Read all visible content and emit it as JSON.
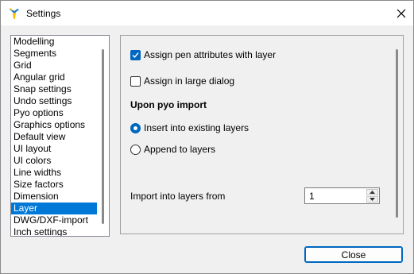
{
  "window": {
    "title": "Settings"
  },
  "sidebar": {
    "items": [
      {
        "label": "Modelling"
      },
      {
        "label": "Segments"
      },
      {
        "label": "Grid"
      },
      {
        "label": "Angular grid"
      },
      {
        "label": "Snap settings"
      },
      {
        "label": "Undo settings"
      },
      {
        "label": "Pyo options"
      },
      {
        "label": "Graphics options"
      },
      {
        "label": "Default view"
      },
      {
        "label": "UI layout"
      },
      {
        "label": "UI colors"
      },
      {
        "label": "Line widths"
      },
      {
        "label": "Size factors"
      },
      {
        "label": "Dimension"
      },
      {
        "label": "Layer"
      },
      {
        "label": "DWG/DXF-import"
      },
      {
        "label": "Inch settings"
      }
    ],
    "selected": "Layer"
  },
  "layer_panel": {
    "assign_pen": {
      "label": "Assign pen attributes with layer",
      "checked": true
    },
    "assign_large_dialog": {
      "label": "Assign in large dialog",
      "checked": false
    },
    "import_heading": "Upon pyo import",
    "insert_existing": {
      "label": "Insert into existing layers",
      "selected": true
    },
    "append_layers": {
      "label": "Append to layers",
      "selected": false
    },
    "import_from": {
      "label": "Import into layers from",
      "value": "1"
    }
  },
  "footer": {
    "close_label": "Close"
  },
  "colors": {
    "accent": "#0067c0",
    "selection": "#0078d7"
  }
}
